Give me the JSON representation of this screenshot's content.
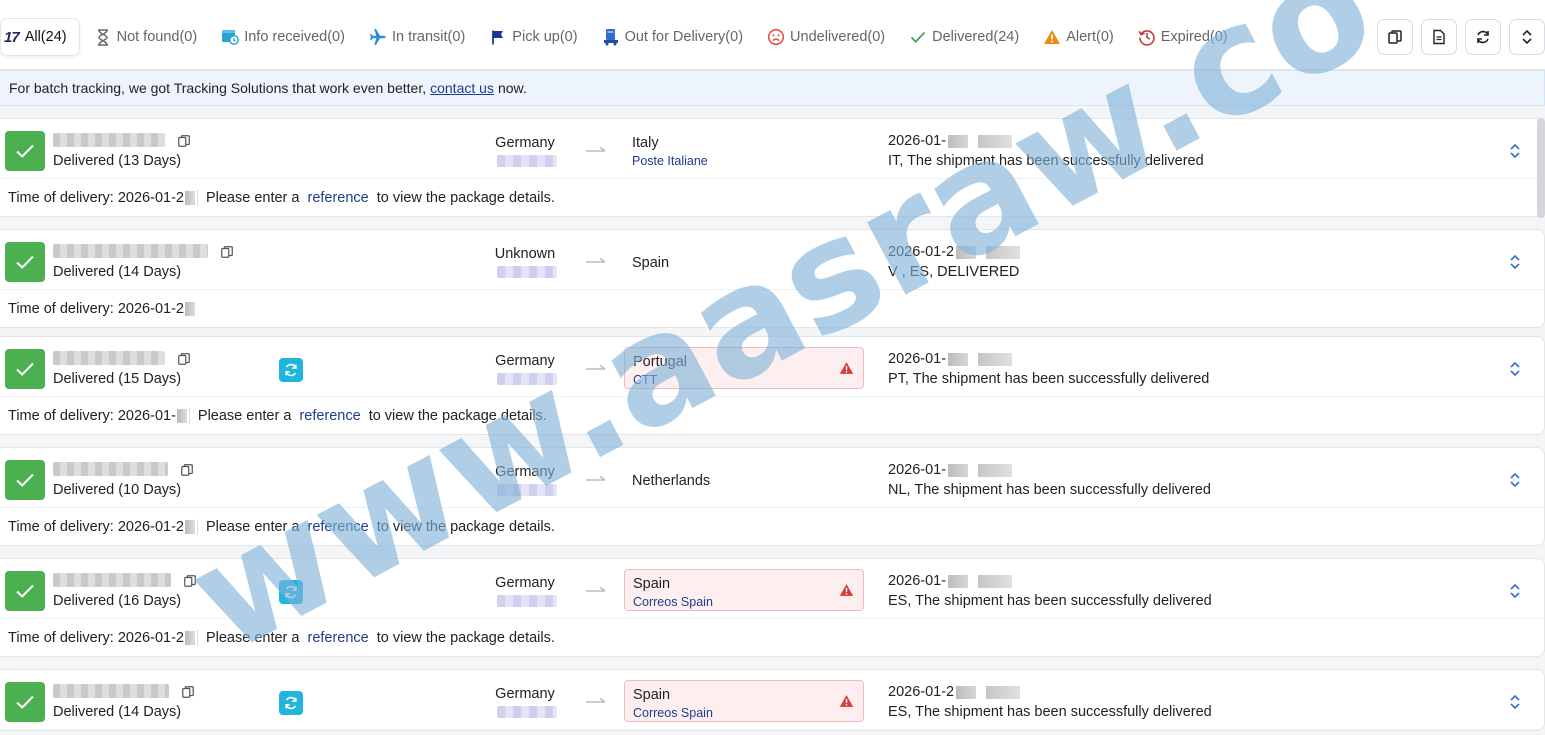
{
  "tabs": [
    {
      "label": "All(24)",
      "icon": "logo-17-icon",
      "logo_text": "17",
      "active": true
    },
    {
      "label": "Not found(0)",
      "icon": "hourglass-icon"
    },
    {
      "label": "Info received(0)",
      "icon": "info-received-icon"
    },
    {
      "label": "In transit(0)",
      "icon": "airplane-icon"
    },
    {
      "label": "Pick up(0)",
      "icon": "flag-icon"
    },
    {
      "label": "Out for Delivery(0)",
      "icon": "delivery-truck-icon"
    },
    {
      "label": "Undelivered(0)",
      "icon": "sad-face-icon"
    },
    {
      "label": "Delivered(24)",
      "icon": "check-icon"
    },
    {
      "label": "Alert(0)",
      "icon": "warning-icon"
    },
    {
      "label": "Expired(0)",
      "icon": "clock-history-icon"
    }
  ],
  "toolbar": [
    "copy-icon",
    "document-icon",
    "refresh-icon",
    "sort-icon"
  ],
  "banner": {
    "prefix": "For batch tracking, we got Tracking Solutions that work even better,",
    "link": "contact us",
    "suffix": "now."
  },
  "shipments": [
    {
      "status": "Delivered (13 Days)",
      "origin": "Germany",
      "dest": "Italy",
      "carrier": "Poste Italiane",
      "alert": false,
      "sync": false,
      "date": "2026-01-",
      "desc": "IT, The shipment has been successfully delivered",
      "delivery": "Time of delivery: 2026-01-2",
      "reference": true
    },
    {
      "status": "Delivered (14 Days)",
      "origin": "Unknown",
      "dest": "Spain",
      "carrier": "",
      "alert": false,
      "sync": false,
      "date": "2026-01-2",
      "desc": "V          , ES, DELIVERED",
      "delivery": "Time of delivery: 2026-01-2",
      "reference": false
    },
    {
      "status": "Delivered (15 Days)",
      "origin": "Germany",
      "dest": "Portugal",
      "carrier": "CTT",
      "alert": true,
      "sync": true,
      "date": "2026-01-",
      "desc": "PT, The shipment has been successfully delivered",
      "delivery": "Time of delivery: 2026-01-",
      "reference": true
    },
    {
      "status": "Delivered (10 Days)",
      "origin": "Germany",
      "dest": "Netherlands",
      "carrier": "",
      "alert": false,
      "sync": false,
      "date": "2026-01-",
      "desc": "NL, The shipment has been successfully delivered",
      "delivery": "Time of delivery: 2026-01-2",
      "reference": true
    },
    {
      "status": "Delivered (16 Days)",
      "origin": "Germany",
      "dest": "Spain",
      "carrier": "Correos Spain",
      "alert": true,
      "sync": true,
      "date": "2026-01-",
      "desc": "ES, The shipment has been successfully delivered",
      "delivery": "Time of delivery: 2026-01-2",
      "reference": true
    },
    {
      "status": "Delivered (14 Days)",
      "origin": "Germany",
      "dest": "Spain",
      "carrier": "Correos Spain",
      "alert": true,
      "sync": true,
      "date": "2026-01-2",
      "desc": "ES, The shipment has been successfully delivered",
      "delivery": "",
      "reference": false
    }
  ],
  "reference_text": {
    "before": "Please enter a",
    "link": "reference",
    "after": "to view the package details."
  },
  "watermark": "www.aasraw.co",
  "colors": {
    "delivered": "#4caf50",
    "sync": "#1fb5dd",
    "alert_bg": "#fdeff0",
    "link": "#1d3c8e",
    "watermark": "#7fb2d9"
  }
}
